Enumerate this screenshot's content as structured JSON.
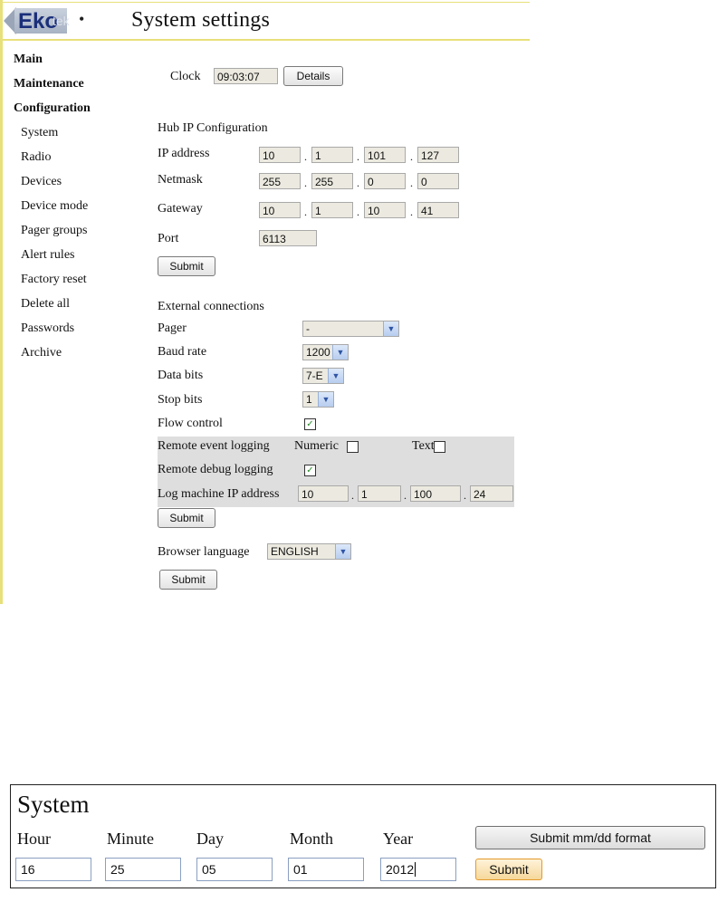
{
  "header": {
    "logo_text": "Eko",
    "logo_suffix": "tek",
    "title": "System settings"
  },
  "nav": {
    "main": "Main",
    "maintenance": "Maintenance",
    "configuration": "Configuration",
    "items": [
      "System",
      "Radio",
      "Devices",
      "Device mode",
      "Pager groups",
      "Alert rules",
      "Factory reset",
      "Delete all",
      "Passwords",
      "Archive"
    ]
  },
  "clock": {
    "label": "Clock",
    "value": "09:03:07",
    "details_button": "Details"
  },
  "hub": {
    "section_title": "Hub IP Configuration",
    "ip_label": "IP address",
    "ip": [
      "10",
      "1",
      "101",
      "127"
    ],
    "netmask_label": "Netmask",
    "netmask": [
      "255",
      "255",
      "0",
      "0"
    ],
    "gateway_label": "Gateway",
    "gateway": [
      "10",
      "1",
      "10",
      "41"
    ],
    "port_label": "Port",
    "port": "6113",
    "submit": "Submit"
  },
  "external": {
    "section_title": "External connections",
    "pager_label": "Pager",
    "pager_value": "-",
    "baud_label": "Baud rate",
    "baud_value": "1200",
    "data_bits_label": "Data bits",
    "data_bits_value": "7-E",
    "stop_bits_label": "Stop bits",
    "stop_bits_value": "1",
    "flow_label": "Flow control",
    "remote_event_label": "Remote event logging",
    "numeric_label": "Numeric",
    "text_label": "Text",
    "remote_debug_label": "Remote debug logging",
    "log_ip_label": "Log machine IP address",
    "log_ip": [
      "10",
      "1",
      "100",
      "24"
    ],
    "submit": "Submit"
  },
  "language": {
    "label": "Browser language",
    "value": "ENGLISH",
    "submit": "Submit"
  },
  "system_dialog": {
    "title": "System",
    "labels": [
      "Hour",
      "Minute",
      "Day",
      "Month",
      "Year"
    ],
    "values": [
      "16",
      "25",
      "05",
      "01",
      "2012"
    ],
    "submit_format": "Submit mm/dd format",
    "submit": "Submit"
  },
  "icons": {
    "checked": "✓",
    "dropdown": "▼"
  }
}
